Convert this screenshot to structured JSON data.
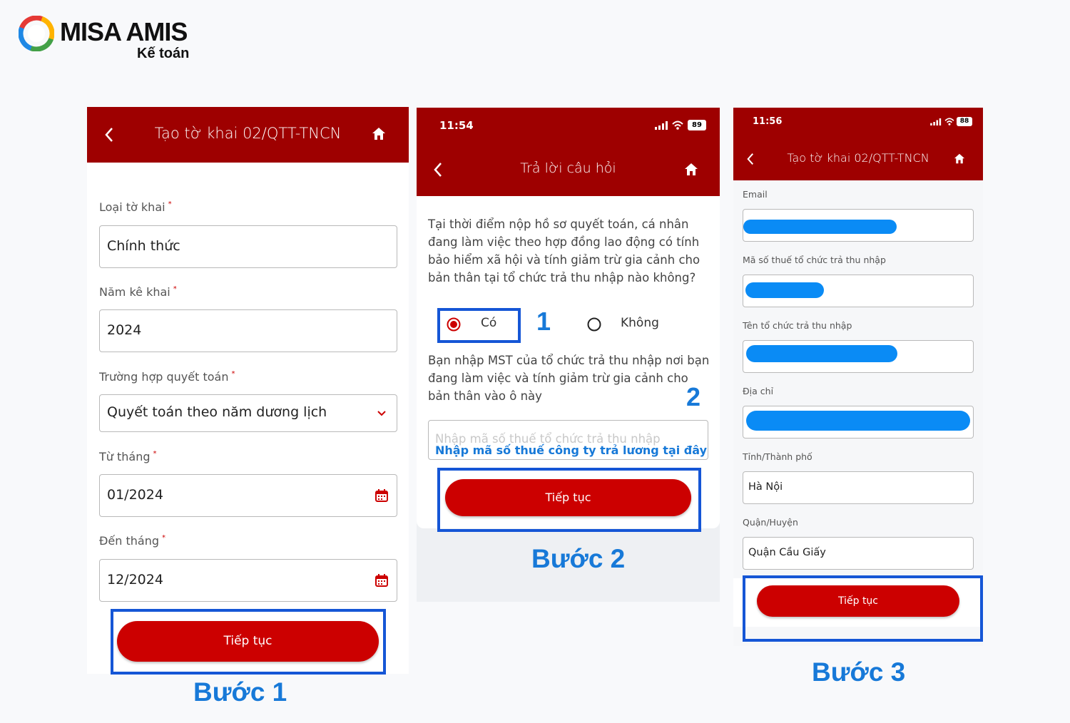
{
  "logo": {
    "name": "MISA AMIS",
    "sub": "Kế toán"
  },
  "step1": {
    "header_title": "Tạo tờ khai 02/QTT-TNCN",
    "fields": [
      {
        "label": "Loại tờ khai",
        "value": "Chính thức"
      },
      {
        "label": "Năm kê khai",
        "value": "2024"
      },
      {
        "label": "Trường hợp quyết toán",
        "value": "Quyết toán theo năm dương lịch"
      },
      {
        "label": "Từ tháng",
        "value": "01/2024"
      },
      {
        "label": "Đến tháng",
        "value": "12/2024"
      }
    ],
    "button_label": "Tiếp tục",
    "step_label": "Bước 1"
  },
  "step2": {
    "time": "11:54",
    "battery": "89",
    "header_title": "Trả lời câu hỏi",
    "question": "Tại thời điểm nộp hồ sơ quyết toán, cá nhân đang làm việc theo hợp đồng lao động có tính bảo hiểm xã hội và tính giảm trừ gia cảnh cho bản thân tại tổ chức trả thu nhập nào không?",
    "option_yes": "Có",
    "option_no": "Không",
    "selected_option": "Có",
    "marker1": "1",
    "instruction": "Bạn nhập MST của tổ chức trả thu nhập nơi bạn đang làm việc và tính giảm trừ gia cảnh cho bản thân vào ô này",
    "marker2": "2",
    "input_placeholder": "Nhập mã số thuế tổ chức trả thu nhập",
    "input_annotation": "Nhập mã số thuế công ty trả lương tại đây",
    "button_label": "Tiếp tục",
    "step_label": "Bước 2"
  },
  "step3": {
    "time": "11:56",
    "battery": "88",
    "header_title": "Tạo tờ khai 02/QTT-TNCN",
    "fields": [
      {
        "label": "Email",
        "value": ""
      },
      {
        "label": "Mã số thuế tổ chức trả thu nhập",
        "value": ""
      },
      {
        "label": "Tên tổ chức trả thu nhập",
        "value": ""
      },
      {
        "label": "Địa chỉ",
        "value": ""
      },
      {
        "label": "Tỉnh/Thành phố",
        "value": "Hà Nội"
      },
      {
        "label": "Quận/Huyện",
        "value": "Quận Cầu Giấy"
      }
    ],
    "button_label": "Tiếp tục",
    "step_label": "Bước 3"
  },
  "colors": {
    "header": "#9e0000",
    "button": "#cc0000",
    "highlight": "#1556d6",
    "step_text": "#1779d8",
    "redaction": "#0a8bf5"
  },
  "icons": [
    "back-chevron-icon",
    "home-icon",
    "calendar-icon",
    "chevron-down-icon",
    "signal-icon",
    "wifi-icon",
    "battery-icon",
    "radio-selected-icon",
    "radio-empty-icon"
  ]
}
